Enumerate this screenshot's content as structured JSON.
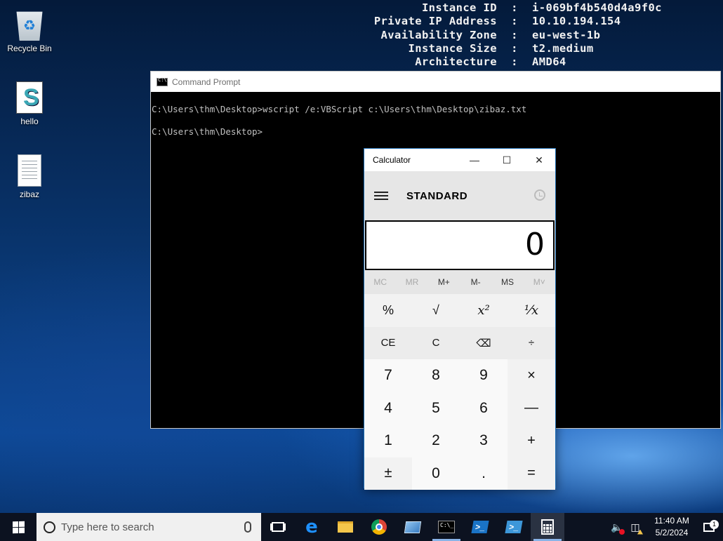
{
  "bginfo": [
    {
      "key": "Instance ID",
      "value": "i-069bf4b540d4a9f0c"
    },
    {
      "key": "Private IP Address",
      "value": "10.10.194.154"
    },
    {
      "key": "Availability Zone",
      "value": "eu-west-1b"
    },
    {
      "key": "Instance Size",
      "value": "t2.medium"
    },
    {
      "key": "Architecture",
      "value": "AMD64"
    }
  ],
  "desktop": {
    "icons": [
      {
        "label": "Recycle Bin",
        "icon": "recycle-bin-icon"
      },
      {
        "label": "hello",
        "icon": "vbscript-file-icon"
      },
      {
        "label": "zibaz",
        "icon": "text-file-icon"
      }
    ]
  },
  "cmd": {
    "title": "Command Prompt",
    "lines": [
      "C:\\Users\\thm\\Desktop>wscript /e:VBScript c:\\Users\\thm\\Desktop\\zibaz.txt",
      "C:\\Users\\thm\\Desktop>"
    ]
  },
  "calculator": {
    "title": "Calculator",
    "mode": "STANDARD",
    "display": "0",
    "memory": [
      "MC",
      "MR",
      "M+",
      "M-",
      "MS",
      "M˅"
    ],
    "keys": [
      [
        "%",
        "√",
        "x²",
        "¹⁄x"
      ],
      [
        "CE",
        "C",
        "⌫",
        "÷"
      ],
      [
        "7",
        "8",
        "9",
        "×"
      ],
      [
        "4",
        "5",
        "6",
        "—"
      ],
      [
        "1",
        "2",
        "3",
        "+"
      ],
      [
        "±",
        "0",
        ".",
        "="
      ]
    ]
  },
  "taskbar": {
    "search_placeholder": "Type here to search",
    "time": "11:40 AM",
    "date": "5/2/2024",
    "notification_count": "1"
  }
}
